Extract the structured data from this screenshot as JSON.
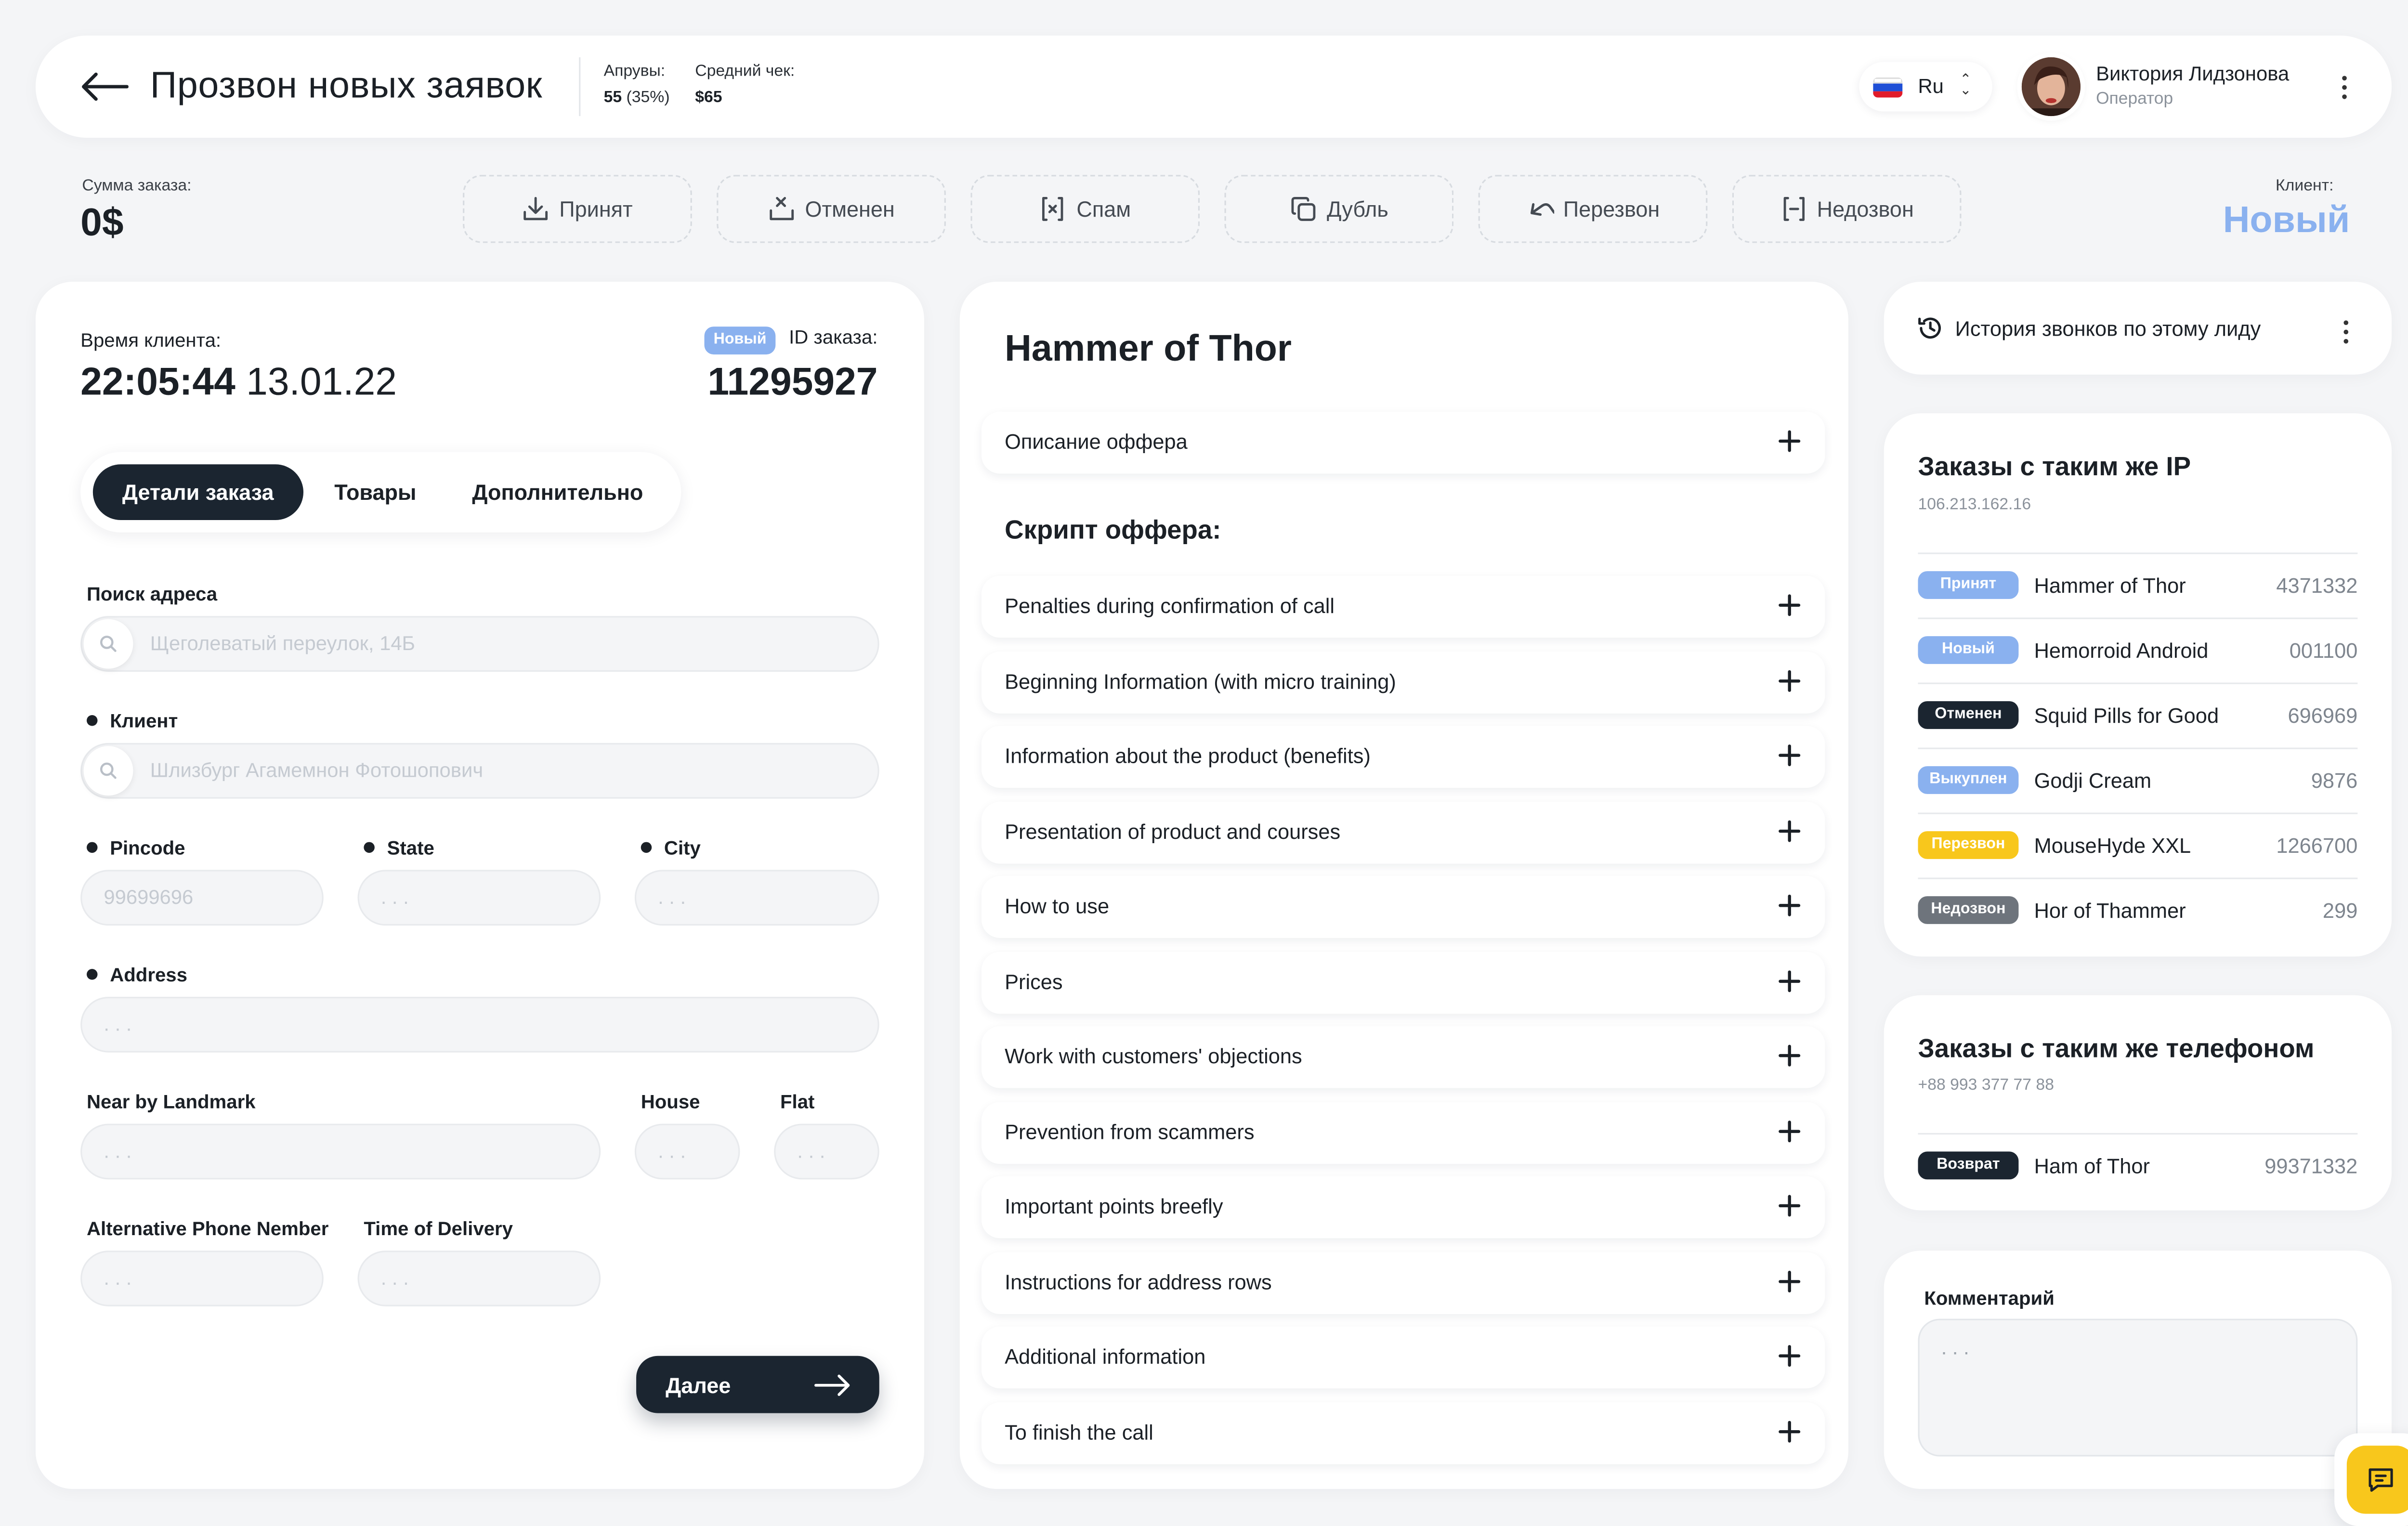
{
  "header": {
    "title": "Прозвон новых заявок",
    "stats": [
      {
        "label": "Апрувы:",
        "value": "55",
        "extra": "(35%)"
      },
      {
        "label": "Средний чек:",
        "value": "$65",
        "extra": ""
      }
    ],
    "language": "Ru",
    "user": {
      "name": "Виктория Лидзонова",
      "role": "Оператор"
    }
  },
  "actions_bar": {
    "sum_label": "Сумма заказа:",
    "sum_value": "0$",
    "buttons": [
      {
        "label": "Принят",
        "icon": "download-icon"
      },
      {
        "label": "Отменен",
        "icon": "cancel-tray-icon"
      },
      {
        "label": "Спам",
        "icon": "spam-icon"
      },
      {
        "label": "Дубль",
        "icon": "duplicate-icon"
      },
      {
        "label": "Перезвон",
        "icon": "callback-icon"
      },
      {
        "label": "Недозвон",
        "icon": "missed-call-icon"
      }
    ],
    "client_label": "Клиент:",
    "client_value": "Новый"
  },
  "order": {
    "time_label": "Время клиента:",
    "time": "22:05:44",
    "date": "13.01.22",
    "status_badge": "Новый",
    "id_label": "ID заказа:",
    "id": "11295927",
    "tabs": [
      "Детали заказа",
      "Товары",
      "Дополнительно"
    ],
    "fields": {
      "address_search": {
        "label": "Поиск адреса",
        "placeholder": "Щеголеватый переулок, 14Б"
      },
      "client": {
        "label": "Клиент",
        "placeholder": "Шлизбург Агамемнон Фотошопович"
      },
      "pincode": {
        "label": "Pincode",
        "placeholder": "99699696"
      },
      "state": {
        "label": "State",
        "placeholder": ". . ."
      },
      "city": {
        "label": "City",
        "placeholder": ". . ."
      },
      "address": {
        "label": "Address",
        "placeholder": ". . ."
      },
      "landmark": {
        "label": "Near by Landmark",
        "placeholder": ". . ."
      },
      "house": {
        "label": "House",
        "placeholder": ". . ."
      },
      "flat": {
        "label": "Flat",
        "placeholder": ". . ."
      },
      "alt_phone": {
        "label": "Alternative Phone Nember",
        "placeholder": ". . ."
      },
      "delivery_time": {
        "label": "Time of Delivery",
        "placeholder": ". . ."
      }
    },
    "next_label": "Далее"
  },
  "offer": {
    "title": "Hammer of Thor",
    "description_label": "Описание оффера",
    "script_title": "Скрипт оффера:",
    "script_items": [
      "Penalties during confirmation of call",
      "Beginning Information (with micro training)",
      "Information about the product (benefits)",
      "Presentation of product and courses",
      "How to use",
      "Prices",
      "Work with customers' objections",
      "Prevention from scammers",
      "Important points breefly",
      "Instructions for address rows",
      "Additional information",
      "To finish the call"
    ]
  },
  "history": {
    "label": "История звонков по этому лиду"
  },
  "same_ip": {
    "title": "Заказы с таким же IP",
    "subtitle": "106.213.162.16",
    "orders": [
      {
        "status": "Принят",
        "color": "#8ab1ef",
        "product": "Hammer of Thor",
        "id": "4371332"
      },
      {
        "status": "Новый",
        "color": "#8ab1ef",
        "product": "Hemorroid Android",
        "id": "001100"
      },
      {
        "status": "Отменен",
        "color": "#1b2530",
        "product": "Squid Pills for Good",
        "id": "696969"
      },
      {
        "status": "Выкуплен",
        "color": "#8ab1ef",
        "product": "Godji Cream",
        "id": "9876"
      },
      {
        "status": "Перезвон",
        "color": "#f8c71c",
        "product": "MouseHyde XXL",
        "id": "1266700"
      },
      {
        "status": "Недозвон",
        "color": "#6e747c",
        "product": "Hor of Thammer",
        "id": "299"
      }
    ]
  },
  "same_phone": {
    "title": "Заказы с таким же телефоном",
    "subtitle": "+88 993 377 77 88",
    "orders": [
      {
        "status": "Возврат",
        "color": "#1b2530",
        "product": "Ham of Thor",
        "id": "99371332"
      }
    ]
  },
  "comment": {
    "label": "Комментарий",
    "placeholder": ". . ."
  },
  "colors": {
    "accent": "#8ab1ef",
    "dark": "#1b2530",
    "yellow": "#f8c71c"
  }
}
